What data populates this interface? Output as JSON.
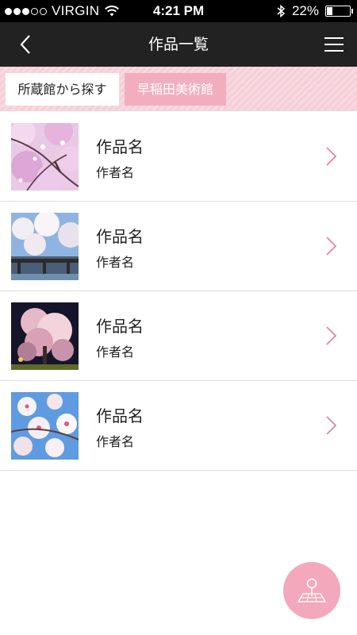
{
  "status_bar": {
    "signal_bars_filled": 3,
    "signal_bars_total": 5,
    "carrier": "VIRGIN",
    "time": "4:21 PM",
    "battery_percent": "22%",
    "battery_level": 0.22,
    "icons": [
      "wifi-icon",
      "bluetooth-icon",
      "battery-icon"
    ]
  },
  "nav": {
    "title": "作品一覧",
    "back_icon": "chevron-left-icon",
    "menu_icon": "hamburger-menu-icon"
  },
  "tabs": [
    {
      "label": "所蔵館から探す",
      "selected": true
    },
    {
      "label": "早稲田美術館",
      "selected": false
    }
  ],
  "artworks": [
    {
      "title": "作品名",
      "author": "作者名",
      "thumbnail": "cherry-blossom-branches-photo"
    },
    {
      "title": "作品名",
      "author": "作者名",
      "thumbnail": "cherry-blossom-bridge-photo"
    },
    {
      "title": "作品名",
      "author": "作者名",
      "thumbnail": "cherry-blossom-night-photo"
    },
    {
      "title": "作品名",
      "author": "作者名",
      "thumbnail": "cherry-blossom-closeup-photo"
    }
  ],
  "map_button": {
    "icon": "map-pin-icon"
  },
  "colors": {
    "nav_background": "#222222",
    "accent_pink": "#f2aebf",
    "tab_strip_pink": "#f7cfd9",
    "chevron_pink": "#e7849e",
    "divider": "#dedede"
  }
}
